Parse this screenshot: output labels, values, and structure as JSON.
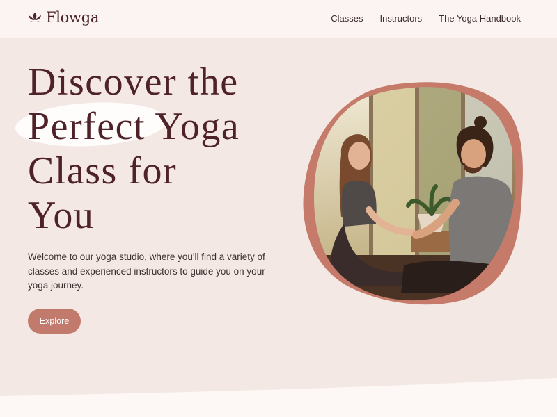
{
  "brand": {
    "name": "Flowga",
    "logo_icon": "lotus-icon"
  },
  "nav": {
    "items": [
      {
        "label": "Classes"
      },
      {
        "label": "Instructors"
      },
      {
        "label": "The Yoga Handbook"
      }
    ]
  },
  "hero": {
    "title_lines": [
      "Discover the",
      "Perfect Yoga",
      "Class for",
      "You"
    ],
    "description": "Welcome to our yoga studio, where you'll find a variety of classes and experienced instructors to guide you on your yoga journey.",
    "cta_label": "Explore"
  },
  "colors": {
    "background": "#f3e8e4",
    "header": "#fbf4f2",
    "accent": "#c27a6c",
    "title": "#4e2228"
  }
}
